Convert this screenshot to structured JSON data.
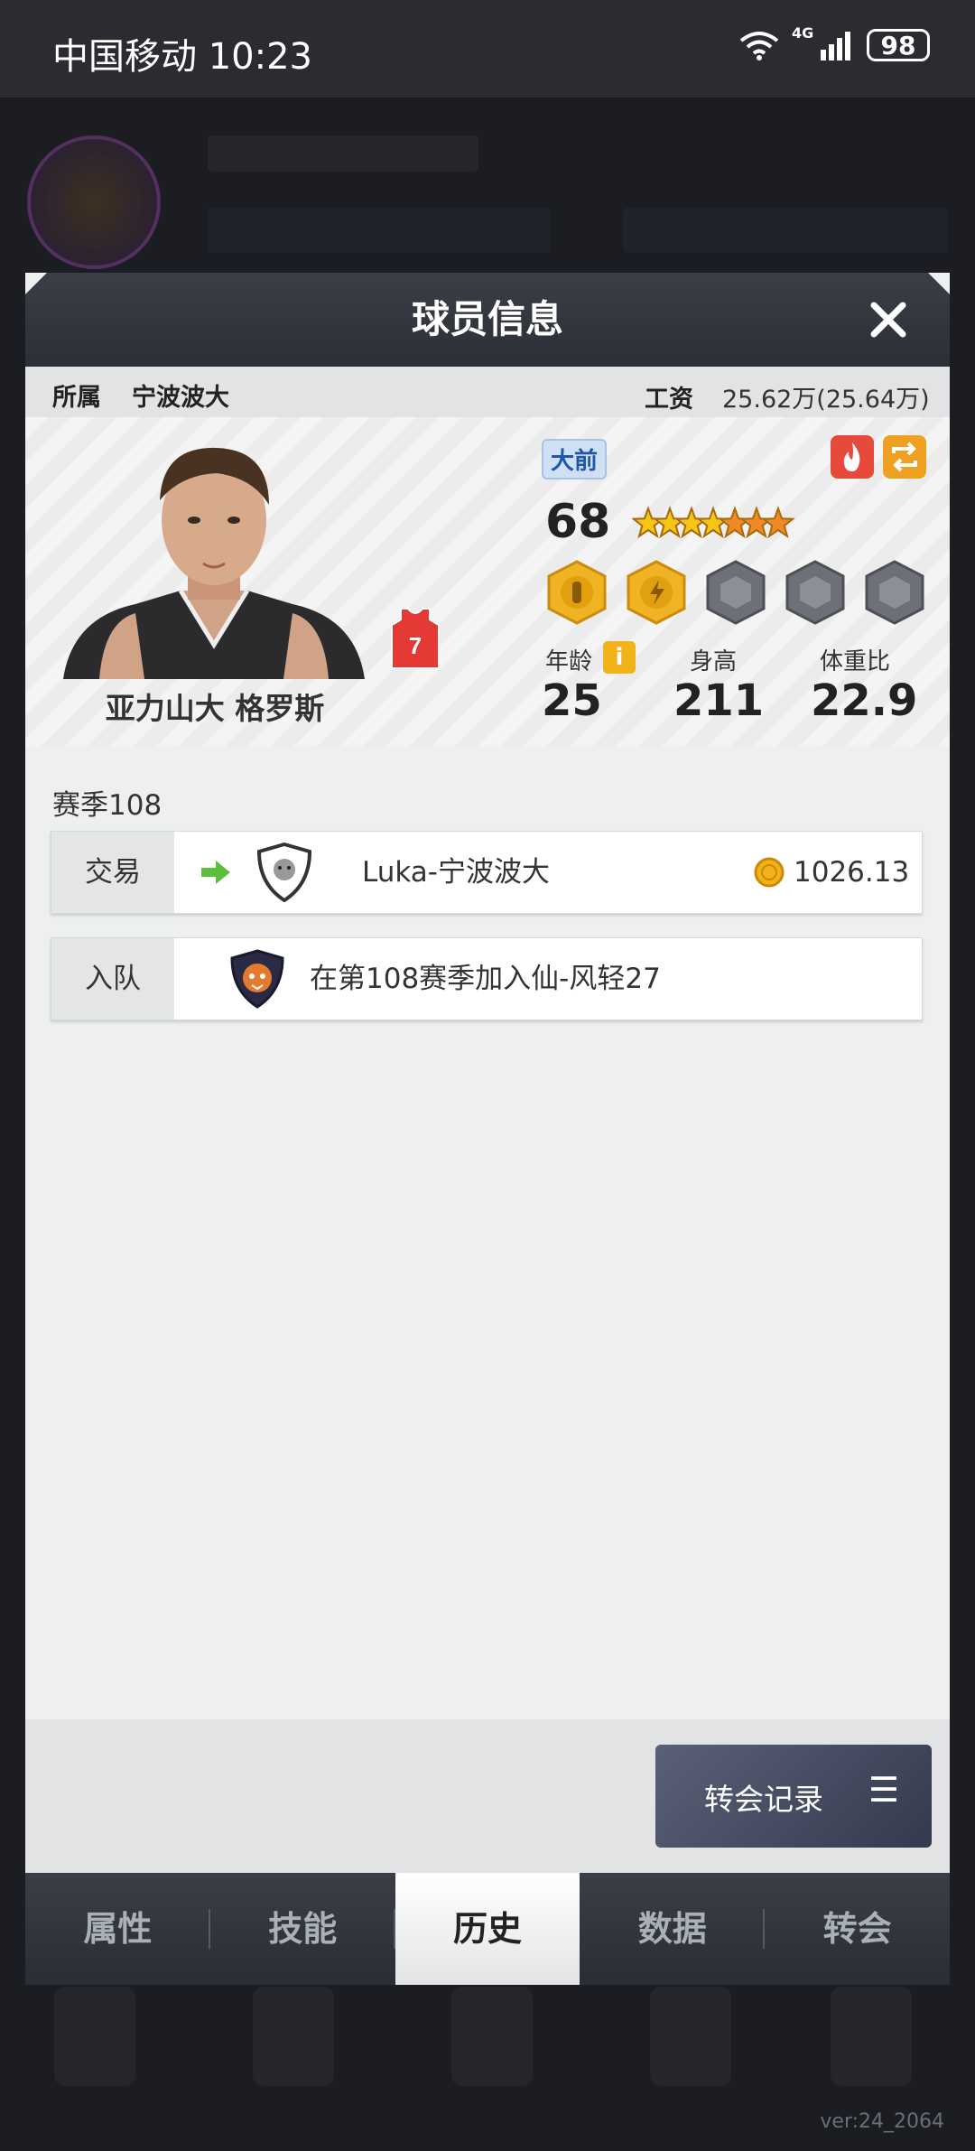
{
  "status_bar": {
    "carrier_time": "中国移动 10:23",
    "network": "4G",
    "battery": "98"
  },
  "modal": {
    "title": "球员信息",
    "affiliation_label": "所属",
    "team": "宁波波大",
    "salary_label": "工资",
    "salary_value": "25.62万(25.64万)",
    "player": {
      "name": "亚力山大 格罗斯",
      "jersey_number": "7",
      "position": "大前",
      "overall": "68",
      "stars": 7,
      "stats": [
        {
          "label": "年龄",
          "value": "25"
        },
        {
          "label": "身高",
          "value": "211"
        },
        {
          "label": "体重比",
          "value": "22.9"
        }
      ]
    },
    "history": {
      "season": "赛季108",
      "entries": [
        {
          "type": "交易",
          "text": "Luka-宁波波大",
          "amount": "1026.13万"
        },
        {
          "type": "入队",
          "text": "在第108赛季加入仙-风轻27"
        }
      ]
    },
    "transfer_record_button": "转会记录",
    "tabs": [
      {
        "label": "属性"
      },
      {
        "label": "技能"
      },
      {
        "label": "历史"
      },
      {
        "label": "数据"
      },
      {
        "label": "转会"
      }
    ],
    "active_tab": "历史"
  },
  "version": "ver:24_2064",
  "colors": {
    "accent_red": "#e64a3a",
    "accent_orange": "#f0a020",
    "coin_gold": "#f2b21a"
  }
}
